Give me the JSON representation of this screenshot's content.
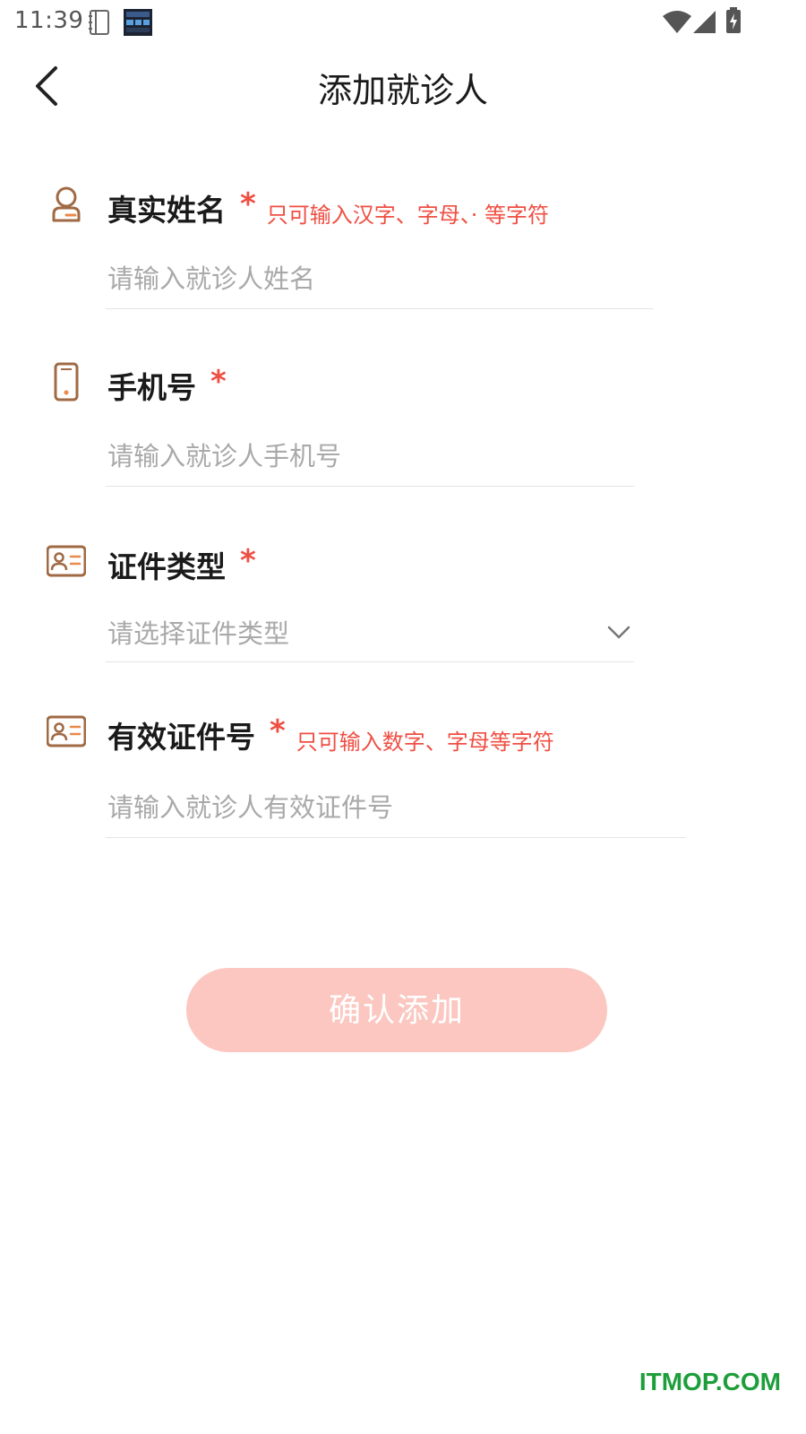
{
  "status_bar": {
    "time": "11:39"
  },
  "header": {
    "title": "添加就诊人"
  },
  "form": {
    "name": {
      "label": "真实姓名",
      "required_mark": "*",
      "hint": "只可输入汉字、字母、· 等字符",
      "placeholder": "请输入就诊人姓名",
      "icon": "person-icon"
    },
    "phone": {
      "label": "手机号",
      "required_mark": "*",
      "placeholder": "请输入就诊人手机号",
      "icon": "phone-icon"
    },
    "id_type": {
      "label": "证件类型",
      "required_mark": "*",
      "placeholder": "请选择证件类型",
      "icon": "id-card-icon"
    },
    "id_number": {
      "label": "有效证件号",
      "required_mark": "*",
      "hint": "只可输入数字、字母等字符",
      "placeholder": "请输入就诊人有效证件号",
      "icon": "id-card-icon"
    }
  },
  "actions": {
    "confirm_label": "确认添加"
  },
  "watermark": {
    "text": "ITMOP.COM"
  },
  "colors": {
    "accent_red": "#ef4f43",
    "icon_brown": "#a06a44",
    "button_disabled": "#fbc7c0"
  }
}
